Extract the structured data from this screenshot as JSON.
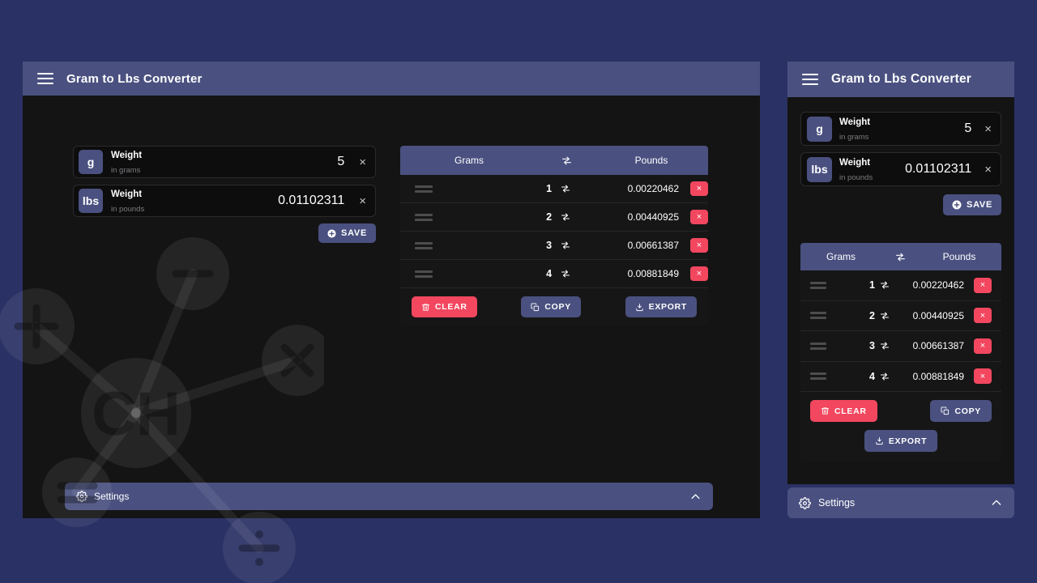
{
  "app": {
    "title": "Gram to Lbs Converter",
    "menu_icon": "hamburger-icon"
  },
  "colors": {
    "page_background": "#2a3164",
    "panel_background": "#141414",
    "accent_blue": "#4a5180",
    "danger_red": "#f2475f",
    "text_primary": "#ffffff",
    "text_muted": "#7d7d82"
  },
  "converter": {
    "from": {
      "unit_chip": "g",
      "label": "Weight",
      "sublabel": "in grams",
      "value": "5",
      "clear_icon": "×"
    },
    "to": {
      "unit_chip": "lbs",
      "label": "Weight",
      "sublabel": "in pounds",
      "value": "0.01102311",
      "clear_icon": "×"
    },
    "save_label": "SAVE"
  },
  "table": {
    "columns": {
      "grams": "Grams",
      "swap": "⇆",
      "pounds": "Pounds"
    },
    "rows": [
      {
        "grams": "1",
        "swap": "⇆",
        "pounds": "0.00220462",
        "delete_icon": "×"
      },
      {
        "grams": "2",
        "swap": "⇆",
        "pounds": "0.00440925",
        "delete_icon": "×"
      },
      {
        "grams": "3",
        "swap": "⇆",
        "pounds": "0.00661387",
        "delete_icon": "×"
      },
      {
        "grams": "4",
        "swap": "⇆",
        "pounds": "0.00881849",
        "delete_icon": "×"
      }
    ],
    "actions": {
      "clear": "CLEAR",
      "copy": "COPY",
      "export": "EXPORT"
    }
  },
  "settings": {
    "label": "Settings",
    "gear_icon": "gear-icon",
    "chevron_icon": "chevron-up-icon"
  },
  "watermark": {
    "center_text": "CH",
    "nodes": [
      "+",
      "−",
      "×",
      "÷",
      "="
    ]
  }
}
